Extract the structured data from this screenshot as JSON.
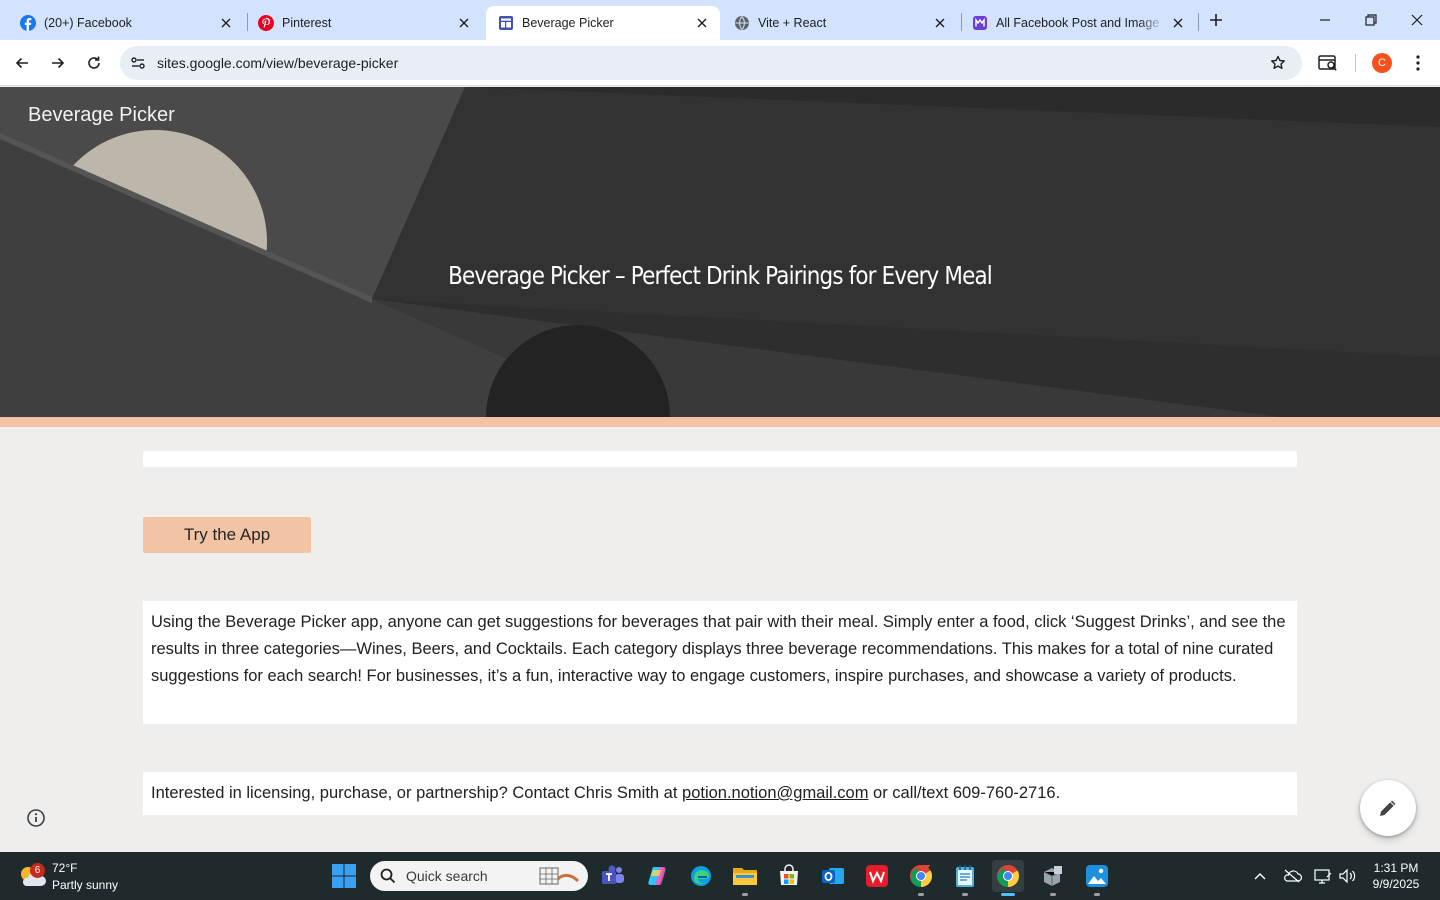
{
  "browser": {
    "tabs": [
      {
        "label": "(20+) Facebook",
        "icon": "facebook-icon"
      },
      {
        "label": "Pinterest",
        "icon": "pinterest-icon"
      },
      {
        "label": "Beverage Picker",
        "icon": "google-sites-icon",
        "active": true
      },
      {
        "label": "Vite + React",
        "icon": "globe-icon"
      },
      {
        "label": "All Facebook Post and Image S",
        "icon": "app-icon"
      }
    ],
    "url": "sites.google.com/view/beverage-picker",
    "profile_initial": "C"
  },
  "page": {
    "site_name": "Beverage Picker",
    "hero_title": "Beverage Picker – Perfect Drink Pairings for Every Meal",
    "cta_label": "Try the App",
    "description": "Using the Beverage Picker app, anyone can get suggestions for beverages that pair with their meal. Simply enter a food, click ‘Suggest Drinks’, and see the results in three categories—Wines, Beers, and Cocktails. Each category displays three beverage recommendations. This makes for a total of nine curated suggestions for each search! For businesses, it’s a fun, interactive way to engage customers, inspire purchases, and showcase a variety of products.",
    "contact_prefix": "Interested in licensing, purchase, or partnership? Contact Chris Smith at ",
    "contact_email": "potion.notion@gmail.com",
    "contact_suffix": " or call/text 609-760-2716."
  },
  "taskbar": {
    "weather_temp": "72°F",
    "weather_condition": "Partly sunny",
    "weather_badge": "6",
    "search_placeholder": "Quick search",
    "time": "1:31 PM",
    "date": "9/9/2025"
  },
  "colors": {
    "accent": "#f2c4a3",
    "tabstrip": "#d3e3fd",
    "hero_bg": "#2f2f2f",
    "page_bg": "#efeeec",
    "taskbar": "#1f2a2c"
  }
}
